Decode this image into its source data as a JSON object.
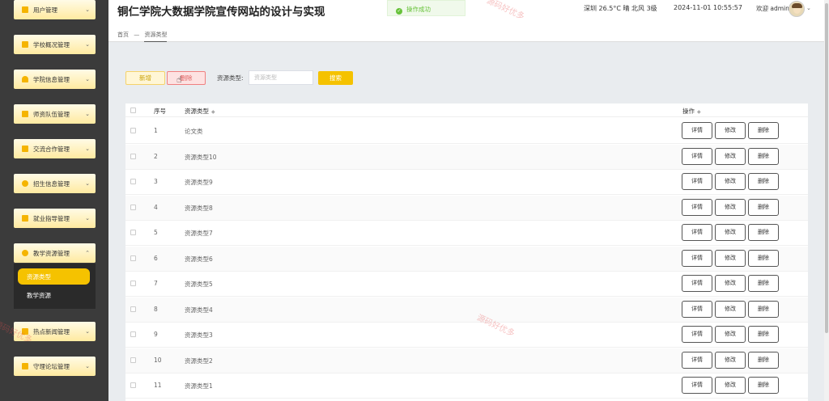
{
  "header": {
    "site_title": "铜仁学院大数据学院宣传网站的设计与实现",
    "toast": "操作成功",
    "weather": "深圳 26.5°C 晴 北风 3级",
    "datetime": "2024-11-01 10:55:57",
    "welcome": "欢迎 admin"
  },
  "breadcrumb": {
    "home": "首页",
    "separator": "—",
    "current": "资源类型"
  },
  "sidebar": {
    "items": [
      {
        "label": "用户管理"
      },
      {
        "label": "学校概况管理"
      },
      {
        "label": "学院信息管理"
      },
      {
        "label": "师资队伍管理"
      },
      {
        "label": "交流合作管理"
      },
      {
        "label": "招生信息管理"
      },
      {
        "label": "就业指导管理"
      },
      {
        "label": "教学资源管理",
        "expanded": true
      },
      {
        "label": "热点新闻管理"
      },
      {
        "label": "守理论坛管理"
      }
    ],
    "submenu": {
      "active": "资源类型",
      "other": "教学资源"
    }
  },
  "toolbar": {
    "add_label": "新增",
    "delete_label": "删除",
    "search_label": "资源类型:",
    "search_placeholder": "资源类型",
    "search_button": "搜索"
  },
  "table": {
    "headers": {
      "index": "序号",
      "type": "资源类型",
      "actions": "操作"
    },
    "action_labels": {
      "detail": "详情",
      "edit": "修改",
      "delete": "删除"
    },
    "rows": [
      {
        "index": "1",
        "type": "论文类"
      },
      {
        "index": "2",
        "type": "资源类型10"
      },
      {
        "index": "3",
        "type": "资源类型9"
      },
      {
        "index": "4",
        "type": "资源类型8"
      },
      {
        "index": "5",
        "type": "资源类型7"
      },
      {
        "index": "6",
        "type": "资源类型6"
      },
      {
        "index": "7",
        "type": "资源类型5"
      },
      {
        "index": "8",
        "type": "资源类型4"
      },
      {
        "index": "9",
        "type": "资源类型3"
      },
      {
        "index": "10",
        "type": "资源类型2"
      },
      {
        "index": "11",
        "type": "资源类型1"
      }
    ]
  },
  "watermark": "源码好优多",
  "colors": {
    "accent": "#f5c200",
    "sidebar_bg": "#3b3b3b",
    "success": "#67c23a",
    "danger": "#f08080"
  }
}
